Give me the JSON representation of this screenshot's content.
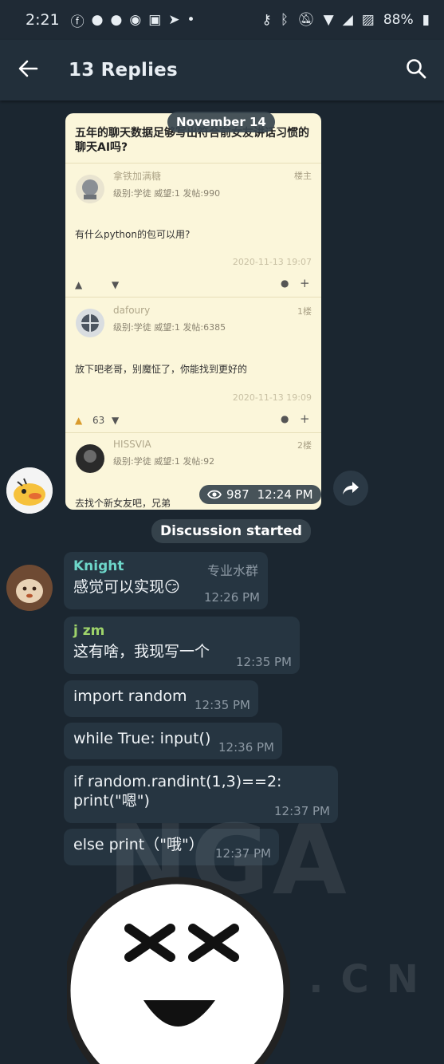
{
  "status_bar": {
    "time": "2:21",
    "battery": "88%"
  },
  "app_bar": {
    "title": "13 Replies"
  },
  "date_pill": "November 14",
  "photo": {
    "title": "五年的聊天数据足够写出符合前女友讲话习惯的聊天AI吗?",
    "post1": {
      "username": "拿铁加满糖",
      "badge": "楼主",
      "meta": "级别:学徒  威望:1  发帖:990",
      "text": "有什么python的包可以用?",
      "date": "2020-11-13 19:07"
    },
    "post2": {
      "username": "dafoury",
      "floor": "1楼",
      "meta": "级别:学徒  威望:1  发帖:6385",
      "text": "放下吧老哥，别魔怔了，你能找到更好的",
      "date": "2020-11-13 19:09",
      "likes": "63"
    },
    "post3": {
      "username": "HISSVIA",
      "floor": "2楼",
      "meta": "级别:学徒  威望:1  发帖:92",
      "text": "去找个新女友吧，兄弟"
    }
  },
  "views": "987",
  "photo_time": "12:24 PM",
  "service_message": "Discussion started",
  "messages": [
    {
      "sender": "Knight",
      "role": "专业水群",
      "text": "感觉可以实现😏",
      "time": "12:26 PM"
    },
    {
      "sender": "j zm",
      "text": "这有啥，我现写一个",
      "time": "12:35 PM"
    },
    {
      "text": "import random",
      "time": "12:35 PM"
    },
    {
      "text": "while True: input()",
      "time": "12:36 PM"
    },
    {
      "text": "if random.randint(1,3)==2: print(\"嗯\")",
      "time": "12:37 PM"
    },
    {
      "text": "else print（\"哦\"）",
      "time": "12:37 PM"
    }
  ],
  "watermark": {
    "main": "NGA",
    "sub": "CA.CN"
  },
  "colors": {
    "background": "#1b2630",
    "bubble": "#263541",
    "knight_name": "#6dd6c9",
    "jzm_name": "#9ed36a"
  }
}
